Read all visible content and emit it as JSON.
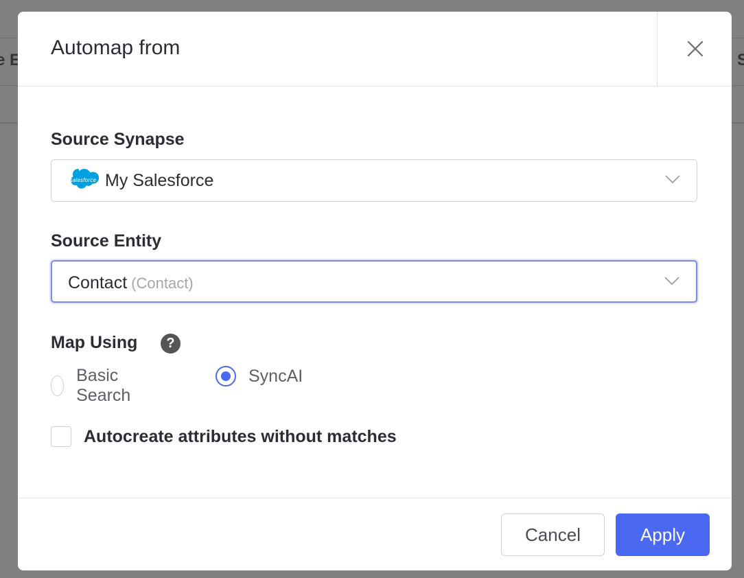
{
  "background": {
    "left_fragment": "e E",
    "right_fragment": "S"
  },
  "dialog": {
    "title": "Automap from",
    "close_icon": "close-icon",
    "source_synapse": {
      "label": "Source Synapse",
      "value": "My Salesforce",
      "icon": "salesforce-logo",
      "logo_text": "salesforce"
    },
    "source_entity": {
      "label": "Source Entity",
      "value": "Contact",
      "secondary": "(Contact)"
    },
    "map_using": {
      "label": "Map Using",
      "help_icon": "?",
      "options": [
        {
          "label": "Basic Search",
          "checked": false
        },
        {
          "label": "SyncAI",
          "checked": true
        }
      ]
    },
    "autocreate": {
      "label": "Autocreate attributes without matches",
      "checked": false
    },
    "footer": {
      "cancel_label": "Cancel",
      "apply_label": "Apply"
    }
  },
  "colors": {
    "accent": "#4a68f0",
    "overlay": "#808080",
    "focus_border": "#7b89f0",
    "salesforce_blue": "#00a1e0"
  }
}
